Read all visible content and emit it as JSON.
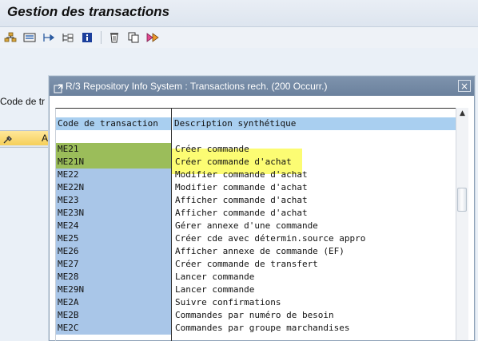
{
  "app": {
    "title": "Gestion des transactions"
  },
  "toolbar": {
    "buttons": [
      "hierarchy-icon",
      "display-icon",
      "expand-icon",
      "subtree-icon",
      "info-icon",
      "delete-icon",
      "copy-icon",
      "execute-icon"
    ]
  },
  "background": {
    "field_label": "Code de tr",
    "button_text": "A"
  },
  "dialog": {
    "title": "R/3 Repository Info System : Transactions rech. (200 Occurr.)",
    "close_symbol": "×",
    "columns": {
      "code": "Code de transaction",
      "description": "Description synthétique"
    },
    "rows": [
      {
        "code": "ME21",
        "description": "Créer commande",
        "highlight": true
      },
      {
        "code": "ME21N",
        "description": "Créer commande d'achat",
        "highlight": true
      },
      {
        "code": "ME22",
        "description": "Modifier commande d'achat"
      },
      {
        "code": "ME22N",
        "description": "Modifier commande d'achat"
      },
      {
        "code": "ME23",
        "description": "Afficher commande d'achat"
      },
      {
        "code": "ME23N",
        "description": "Afficher commande d'achat"
      },
      {
        "code": "ME24",
        "description": "Gérer annexe d'une commande"
      },
      {
        "code": "ME25",
        "description": "Créer cde avec détermin.source appro"
      },
      {
        "code": "ME26",
        "description": "Afficher annexe de commande (EF)"
      },
      {
        "code": "ME27",
        "description": "Créer commande de transfert"
      },
      {
        "code": "ME28",
        "description": "Lancer commande"
      },
      {
        "code": "ME29N",
        "description": "Lancer commande"
      },
      {
        "code": "ME2A",
        "description": "Suivre confirmations"
      },
      {
        "code": "ME2B",
        "description": "Commandes par numéro de besoin"
      },
      {
        "code": "ME2C",
        "description": "Commandes par groupe marchandises"
      }
    ]
  }
}
